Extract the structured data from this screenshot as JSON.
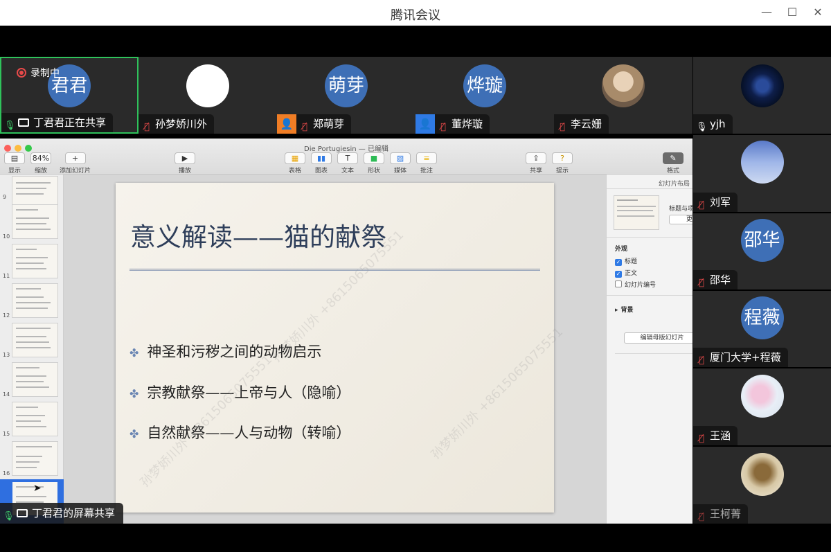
{
  "window": {
    "title": "腾讯会议",
    "minimize": "—",
    "maximize": "☐",
    "close": "✕"
  },
  "recording": {
    "label": "录制中"
  },
  "participants_top": [
    {
      "avatar": "君君",
      "name": "丁君君正在共享",
      "mic": "on",
      "active": true
    },
    {
      "avatar": "",
      "name": "孙梦娇川外",
      "mic": "off"
    },
    {
      "avatar": "萌芽",
      "name": "郑萌芽",
      "mic": "off"
    },
    {
      "avatar": "烨璇",
      "name": "董烨璇",
      "mic": "off"
    },
    {
      "avatar": "",
      "name": "李云姗",
      "mic": "off"
    }
  ],
  "participants_side": [
    {
      "avatar": "",
      "name": "yjh",
      "mic": "on"
    },
    {
      "avatar": "",
      "name": "刘军",
      "mic": "off"
    },
    {
      "avatar": "邵华",
      "name": "邵华",
      "mic": "off"
    },
    {
      "avatar": "程薇",
      "name": "厦门大学+程薇",
      "mic": "off"
    },
    {
      "avatar": "",
      "name": "王涵",
      "mic": "off"
    },
    {
      "avatar": "",
      "name": "王柯菁",
      "mic": "off"
    }
  ],
  "share": {
    "label": "丁君君的屏幕共享",
    "doc_title": "Die Portugiesin — 已编辑",
    "zoom": "84%",
    "toolbar": {
      "view": "显示",
      "zoom": "缩放",
      "add_slide": "添加幻灯片",
      "play": "播放",
      "table": "表格",
      "chart": "图表",
      "text": "文本",
      "shape": "形状",
      "media": "媒体",
      "comment": "批注",
      "share": "共享",
      "tips": "提示",
      "format": "格式"
    },
    "thumbnails": [
      "9",
      "10",
      "11",
      "12",
      "13",
      "14",
      "15",
      "16"
    ],
    "slide": {
      "title": "意义解读——猫的献祭",
      "bullets": [
        "神圣和污秽之间的动物启示",
        "宗教献祭——上帝与人（隐喻）",
        "自然献祭——人与动物（转喻）"
      ],
      "watermark": "孙梦娇川外 +8615065075551"
    },
    "inspector": {
      "header": "幻灯片布局",
      "layout_name": "标题与项",
      "layout_btn": "更",
      "appearance": "外观",
      "title_chk": "标题",
      "body_chk": "正文",
      "number_chk": "幻灯片编号",
      "background": "背景",
      "edit_master": "编辑母版幻灯片"
    }
  }
}
